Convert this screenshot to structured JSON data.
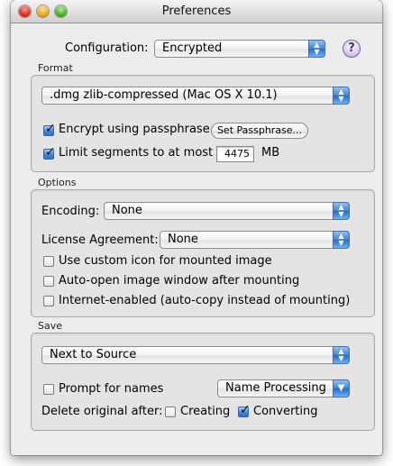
{
  "window": {
    "title": "Preferences"
  },
  "configuration": {
    "label": "Configuration:",
    "value": "Encrypted",
    "help": "?"
  },
  "format": {
    "section_label": "Format",
    "type_value": ".dmg zlib-compressed (Mac OS X 10.1)",
    "encrypt_label": "Encrypt using passphrase",
    "encrypt_checked": true,
    "set_passphrase_label": "Set Passphrase...",
    "limit_label": "Limit segments to at most",
    "limit_checked": true,
    "limit_value": "4475",
    "limit_unit": "MB"
  },
  "options": {
    "section_label": "Options",
    "encoding_label": "Encoding:",
    "encoding_value": "None",
    "license_label": "License Agreement:",
    "license_value": "None",
    "custom_icon_label": "Use custom icon for mounted image",
    "custom_icon_checked": false,
    "auto_open_label": "Auto-open image window after mounting",
    "auto_open_checked": false,
    "internet_label": "Internet-enabled (auto-copy instead of mounting)",
    "internet_checked": false
  },
  "save": {
    "section_label": "Save",
    "location_value": "Next to Source",
    "prompt_label": "Prompt for names",
    "prompt_checked": false,
    "name_processing_value": "Name Processing",
    "delete_label": "Delete original after:",
    "creating_label": "Creating",
    "creating_checked": false,
    "converting_label": "Converting",
    "converting_checked": true
  }
}
